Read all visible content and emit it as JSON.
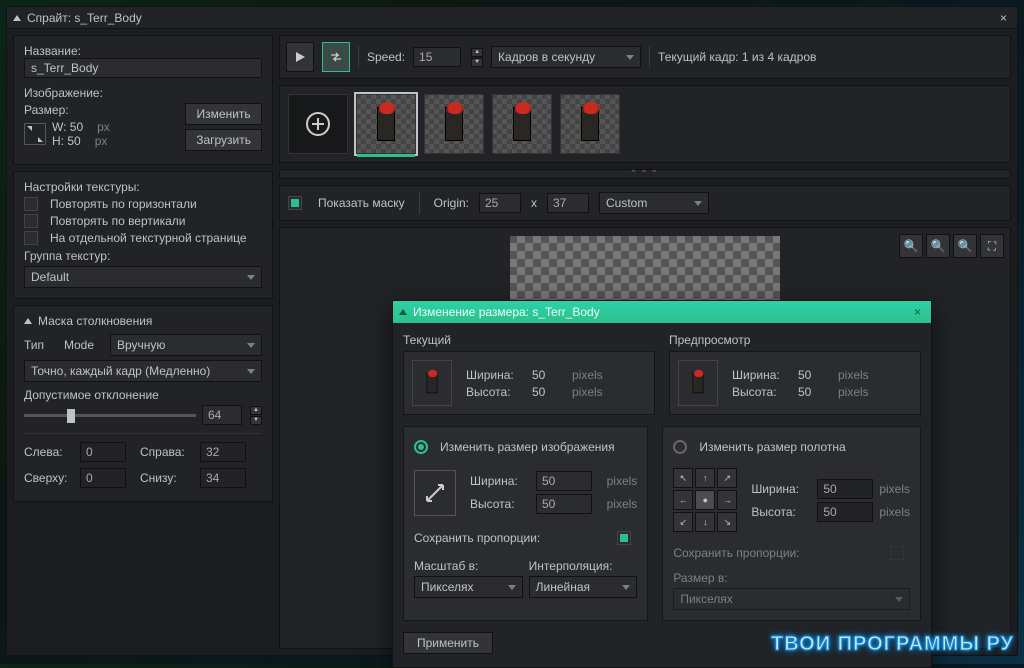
{
  "window": {
    "title": "Спрайт: s_Terr_Body"
  },
  "left": {
    "name_label": "Название:",
    "name_value": "s_Terr_Body",
    "image_label": "Изображение:",
    "size_label": "Размер:",
    "w_label": "W: 50",
    "h_label": "H: 50",
    "px": "px",
    "edit_btn": "Изменить",
    "load_btn": "Загрузить",
    "tex_settings": "Настройки текстуры:",
    "tile_h": "Повторять по горизонтали",
    "tile_v": "Повторять по вертикали",
    "sep_page": "На отдельной текстурной странице",
    "tex_group": "Группа текстур:",
    "tex_group_val": "Default",
    "coll_mask": "Маска столкновения",
    "type_lbl": "Тип",
    "mode_lbl": "Mode",
    "mode_val": "Вручную",
    "precision_val": "Точно, каждый кадр (Медленно)",
    "tolerance": "Допустимое отклонение",
    "tolerance_val": "64",
    "left_lbl": "Слева:",
    "left_val": "0",
    "right_lbl": "Справа:",
    "right_val": "32",
    "top_lbl": "Сверху:",
    "top_val": "0",
    "bottom_lbl": "Снизу:",
    "bottom_val": "34"
  },
  "toolbar": {
    "speed_lbl": "Speed:",
    "speed_val": "15",
    "fps_val": "Кадров в секунду",
    "current_frame": "Текущий кадр: 1 из 4 кадров"
  },
  "maskbar": {
    "show_mask": "Показать маску",
    "origin_lbl": "Origin:",
    "ox": "25",
    "oy": "37",
    "x": "x",
    "origin_preset": "Custom"
  },
  "dialog": {
    "title": "Изменение размера: s_Terr_Body",
    "current": "Текущий",
    "preview": "Предпросмотр",
    "width_lbl": "Ширина:",
    "height_lbl": "Высота:",
    "w_cur": "50",
    "h_cur": "50",
    "w_prev": "50",
    "h_prev": "50",
    "pixels": "pixels",
    "resize_image": "Изменить размер изображения",
    "resize_canvas": "Изменить размер полотна",
    "w_new": "50",
    "h_new": "50",
    "keep_ratio": "Сохранить пропорции:",
    "scale_in": "Масштаб в:",
    "interp": "Интерполяция:",
    "scale_val": "Пикселях",
    "interp_val": "Линейная",
    "size_in": "Размер в:",
    "size_val": "Пикселях",
    "apply": "Применить"
  },
  "watermark": "ТВОИ ПРОГРАММЫ РУ"
}
